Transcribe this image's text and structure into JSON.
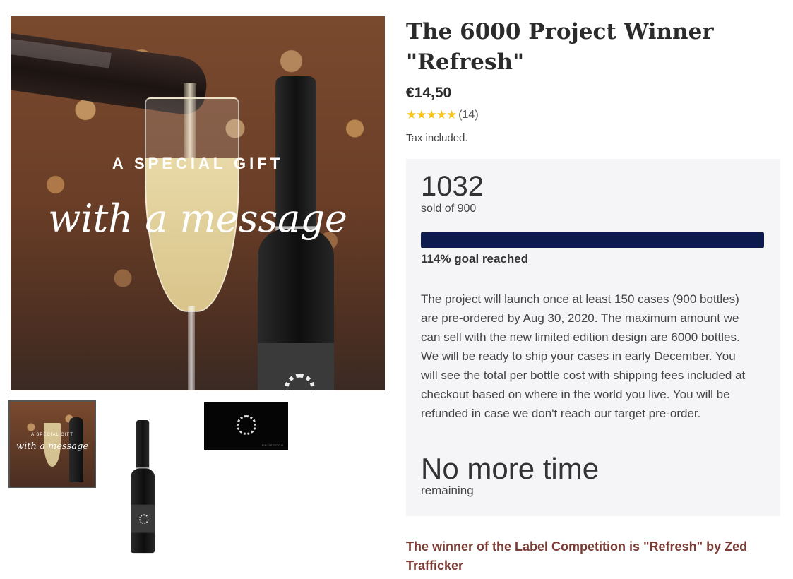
{
  "gallery": {
    "main_image": {
      "overlay_line1": "A SPECIAL GIFT",
      "overlay_line2": "with a message"
    },
    "thumb_1": {
      "overlay_line1": "A SPECIAL GIFT",
      "overlay_line2": "with a message"
    },
    "thumb_3_label": "PROSECCO"
  },
  "product": {
    "title": "The 6000 Project Winner \"Refresh\"",
    "price": "€14,50",
    "rating_count": "(14)",
    "rating_stars": 5,
    "tax_note": "Tax included."
  },
  "campaign": {
    "sold_count": "1032",
    "sold_of": "sold of 900",
    "progress_fraction": 1.0,
    "goal_text": "114% goal reached",
    "description": "The project will launch once at least 150 cases (900 bottles) are pre-ordered by Aug 30, 2020. The maximum amount we can sell with the new limited edition design are 6000 bottles. We will be ready to ship your cases in early December. You will see the total per bottle cost with shipping fees included at checkout based on where in the world you live. You will be refunded in case we don't reach our target pre-order.",
    "time_left": "No more time",
    "time_left_suffix": "remaining",
    "progress_color": "#0d1a4d"
  },
  "winner_note": "The winner of the Label Competition is \"Refresh\" by Zed Trafficker",
  "colors": {
    "panel_bg": "#f5f5f8",
    "star": "#f5c518",
    "winner_text": "#7a3b34"
  },
  "icons": {
    "rating": "star-icon"
  }
}
